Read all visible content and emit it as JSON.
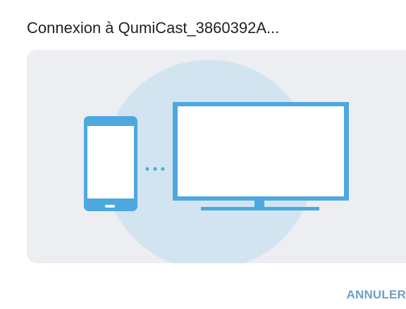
{
  "dialog": {
    "title": "Connexion à QumiCast_3860392A...",
    "cancel_label": "ANNULER"
  },
  "illustration": {
    "icons": [
      "phone-icon",
      "connecting-dots-icon",
      "tv-icon"
    ]
  },
  "colors": {
    "accent": "#4da8e0",
    "circle": "#d2e4ef",
    "panel": "#eceef1",
    "button_text": "#6f9fc7"
  }
}
